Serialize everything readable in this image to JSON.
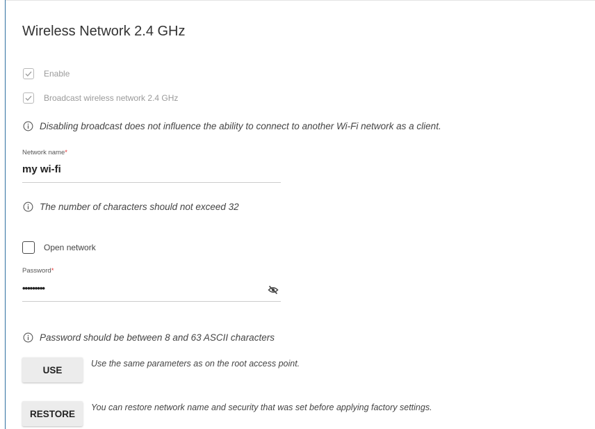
{
  "section": {
    "title": "Wireless Network 2.4 GHz"
  },
  "enable": {
    "label": "Enable",
    "checked": true
  },
  "broadcast": {
    "label": "Broadcast wireless network 2.4 GHz",
    "checked": true
  },
  "broadcast_note": "Disabling broadcast does not influence the ability to connect to another Wi-Fi network as a client.",
  "network_name": {
    "label": "Network name",
    "required_mark": "*",
    "value": "my wi-fi",
    "hint": "The number of characters should not exceed 32"
  },
  "open_network": {
    "label": "Open network",
    "checked": false
  },
  "password": {
    "label": "Password",
    "required_mark": "*",
    "value": "•••••••••",
    "toggle_icon": "eye-slash-icon",
    "hint": "Password should be between 8 and 63 ASCII characters"
  },
  "use_action": {
    "button_label": "USE",
    "description": "Use the same parameters as on the root access point."
  },
  "restore_action": {
    "button_label": "RESTORE",
    "description": "You can restore network name and security that was set before applying factory settings."
  },
  "colors": {
    "accent_rule": "#2e6fa0",
    "required": "#e03030",
    "button_bg": "#ececec"
  }
}
